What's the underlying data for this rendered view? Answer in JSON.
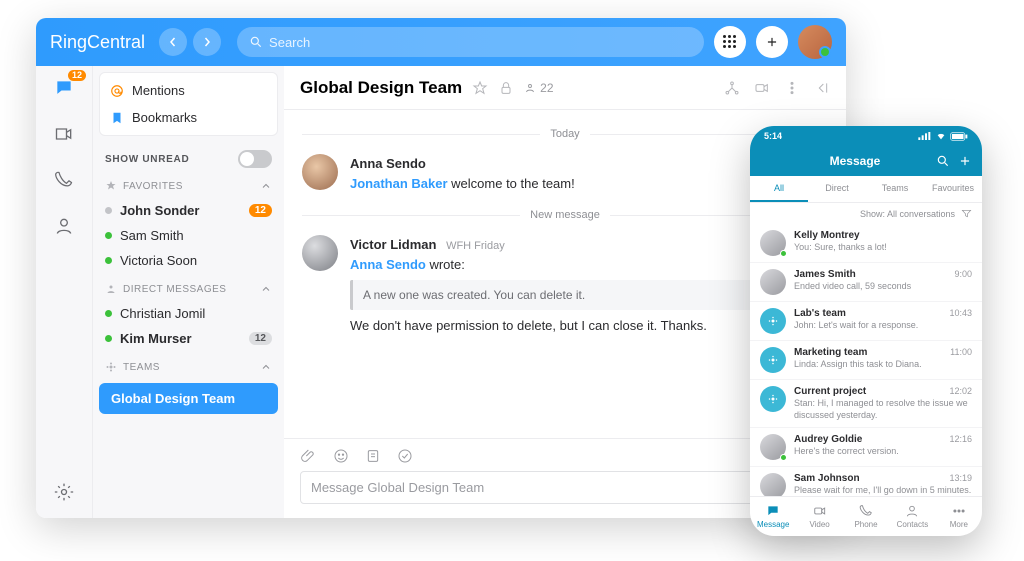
{
  "brand": "RingCentral",
  "search_placeholder": "Search",
  "rail_badge": "12",
  "sidebar": {
    "mentions": "Mentions",
    "bookmarks": "Bookmarks",
    "show_unread": "SHOW UNREAD",
    "favorites_hdr": "FAVORITES",
    "dm_hdr": "DIRECT MESSAGES",
    "teams_hdr": "TEAMS",
    "favorites": [
      {
        "name": "John Sonder",
        "bold": true,
        "online": false,
        "badge": "12",
        "badge_kind": "o"
      },
      {
        "name": "Sam Smith",
        "bold": false,
        "online": true
      },
      {
        "name": "Victoria Soon",
        "bold": false,
        "online": true
      }
    ],
    "dms": [
      {
        "name": "Christian Jomil",
        "bold": false,
        "online": true
      },
      {
        "name": "Kim Murser",
        "bold": true,
        "online": true,
        "badge": "12",
        "badge_kind": "g"
      }
    ],
    "team_active": "Global Design Team"
  },
  "conversation": {
    "title": "Global Design Team",
    "member_count": "22",
    "today_divider": "Today",
    "newmsg_divider": "New message",
    "messages": [
      {
        "author": "Anna Sendo",
        "mention": "Jonathan Baker",
        "after_mention": " welcome to the team!"
      },
      {
        "author": "Victor Lidman",
        "meta": "WFH Friday",
        "reply_to": "Anna Sendo",
        "reply_suffix": " wrote:",
        "quote": "A new one was created. You can delete it.",
        "body": "We don't have permission to delete, but I can close it. Thanks."
      }
    ],
    "composer_placeholder": "Message Global Design Team"
  },
  "mobile": {
    "status_time": "5:14",
    "header": "Message",
    "tabs": [
      "All",
      "Direct",
      "Teams",
      "Favourites"
    ],
    "filter_label": "Show: All conversations",
    "items": [
      {
        "name": "Kelly Montrey",
        "sub": "You: Sure, thanks a lot!",
        "time": "",
        "person": true,
        "online": true
      },
      {
        "name": "James Smith",
        "sub": "Ended video call, 59 seconds",
        "time": "9:00",
        "person": true
      },
      {
        "name": "Lab's team",
        "sub": "John: Let's wait for a response.",
        "time": "10:43",
        "person": false
      },
      {
        "name": "Marketing team",
        "sub": "Linda: Assign this task to Diana.",
        "time": "11:00",
        "person": false
      },
      {
        "name": "Current project",
        "sub": "Stan: Hi, I managed to resolve the issue we discussed yesterday.",
        "time": "12:02",
        "person": false
      },
      {
        "name": "Audrey Goldie",
        "sub": "Here's the correct version.",
        "time": "12:16",
        "person": true,
        "online": true
      },
      {
        "name": "Sam Johnson",
        "sub": "Please wait for me, I'll go down in 5 minutes.",
        "time": "13:19",
        "person": true
      }
    ],
    "bottom": [
      "Message",
      "Video",
      "Phone",
      "Contacts",
      "More"
    ]
  }
}
